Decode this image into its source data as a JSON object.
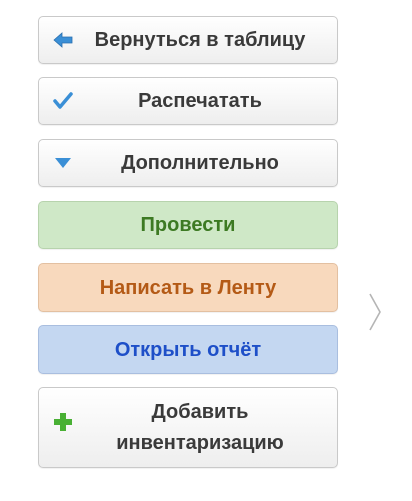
{
  "buttons": {
    "back": {
      "label": "Вернуться в таблицу",
      "icon": "arrow-left-icon"
    },
    "print": {
      "label": "Распечатать",
      "icon": "checkmark-icon"
    },
    "more": {
      "label": "Дополнительно",
      "icon": "triangle-down-icon"
    },
    "post": {
      "label": "Провести"
    },
    "feed": {
      "label": "Написать в Ленту"
    },
    "report": {
      "label": "Открыть отчёт"
    },
    "add": {
      "label_line1": "Добавить",
      "label_line2": "инвентаризацию",
      "icon": "plus-icon"
    }
  },
  "navigation": {
    "next_icon": "chevron-right-icon"
  },
  "colors": {
    "post_text": "#3d7a23",
    "feed_text": "#b45a16",
    "report_text": "#1e4fc8",
    "icon_blue": "#3a8fd6",
    "icon_green": "#49b034"
  }
}
